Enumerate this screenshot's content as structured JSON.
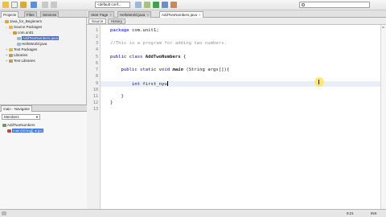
{
  "toolbar": {
    "config_combo": "<default conf...",
    "search_placeholder": ""
  },
  "projects_panel": {
    "tabs": [
      "Projects",
      "Files",
      "Services"
    ],
    "tree": [
      {
        "label": "Java_for_Beginners",
        "level": 0,
        "icon": "project-icon",
        "expander": "-"
      },
      {
        "label": "Source Packages",
        "level": 1,
        "icon": "folder-icon",
        "expander": "-"
      },
      {
        "label": "com.unit1",
        "level": 2,
        "icon": "package-icon",
        "expander": "-"
      },
      {
        "label": "AddTwoNumbers.java",
        "level": 3,
        "icon": "java-file-icon",
        "expander": "",
        "selected": true
      },
      {
        "label": "HelloWorld.java",
        "level": 3,
        "icon": "java-file-icon",
        "expander": ""
      },
      {
        "label": "Test Packages",
        "level": 1,
        "icon": "folder-icon",
        "expander": "+"
      },
      {
        "label": "Libraries",
        "level": 1,
        "icon": "library-icon",
        "expander": "+"
      },
      {
        "label": "Test Libraries",
        "level": 1,
        "icon": "library-icon",
        "expander": "+"
      }
    ]
  },
  "navigator": {
    "title": "main - Navigator",
    "combo": "Members",
    "items": [
      {
        "label": "AddTwoNumbers"
      },
      {
        "label": "main(String[] args)"
      }
    ]
  },
  "editor": {
    "tabs": [
      {
        "label": "Start Page",
        "active": false
      },
      {
        "label": "HelloWorld.java",
        "active": false
      },
      {
        "label": "AddTwoNumbers.java",
        "active": true
      }
    ],
    "modes": [
      "Source",
      "History"
    ],
    "line_numbers": [
      "1",
      "2",
      "3",
      "4",
      "5",
      "6",
      "7",
      "8",
      "9",
      "10",
      "11",
      "12",
      "13"
    ],
    "code": {
      "l1_kw": "package",
      "l1_rest": " com.unit1;",
      "l3": "//This is a program for adding two numbers.",
      "l5_kw1": "public",
      "l5_kw2": " class ",
      "l5_cls": "AddTwoNumbers",
      "l5_rest": " {",
      "l7_kw1": "    public",
      "l7_kw2": " static void ",
      "l7_fn": "main",
      "l7_rest": " (String args[]){",
      "l9_kw": "        int",
      "l9_rest": " first_nyu",
      "l11": "    }",
      "l12": "}"
    }
  },
  "status": {
    "position": "9:21",
    "mode": "INS"
  },
  "colors": {
    "keyword": "#0000cc",
    "comment": "#969696",
    "selection": "#3a6fd6",
    "mouse_highlight": "#ffe646"
  }
}
